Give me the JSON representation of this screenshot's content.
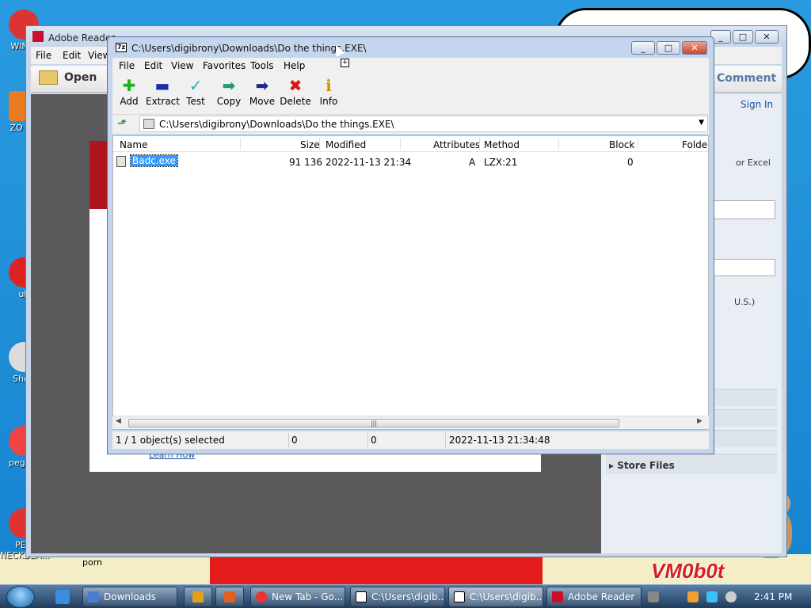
{
  "desktop": {
    "icons": [
      {
        "label": "WIN V"
      },
      {
        "label": "ZO DE"
      },
      {
        "label": "uk"
      },
      {
        "label": "Shop"
      },
      {
        "label": "peg he"
      },
      {
        "label": "PEG NECKBEA..."
      }
    ],
    "porn_label": "porn",
    "vmobot": "VM0b0t"
  },
  "reader": {
    "title": "Adobe Reader",
    "menu": [
      "File",
      "Edit",
      "View"
    ],
    "open_label": "Open",
    "comment_label": "Comment",
    "signin_label": "Sign In",
    "panel_text_excel": "or Excel",
    "panel_text_us": "U.S.)",
    "store_files": "Store Files",
    "doc_link": "Learn How"
  },
  "sevenzip": {
    "title": "C:\\Users\\digibrony\\Downloads\\Do the things.EXE\\",
    "menu": [
      "File",
      "Edit",
      "View",
      "Favorites",
      "Tools",
      "Help"
    ],
    "toolbar": [
      {
        "label": "Add",
        "icon": "plus-icon",
        "color": "#22b022"
      },
      {
        "label": "Extract",
        "icon": "minus-icon",
        "color": "#1a2fb0"
      },
      {
        "label": "Test",
        "icon": "check-icon",
        "color": "#2ab0a8"
      },
      {
        "label": "Copy",
        "icon": "copy-arrow-icon",
        "color": "#1f9a7a"
      },
      {
        "label": "Move",
        "icon": "move-arrow-icon",
        "color": "#1a2a90"
      },
      {
        "label": "Delete",
        "icon": "delete-x-icon",
        "color": "#d51818"
      },
      {
        "label": "Info",
        "icon": "info-icon",
        "color": "#c79800"
      }
    ],
    "address": "C:\\Users\\digibrony\\Downloads\\Do the things.EXE\\",
    "columns": [
      "Name",
      "Size",
      "Modified",
      "Attributes",
      "Method",
      "Block",
      "Folder"
    ],
    "rows": [
      {
        "name": "Badc.exe",
        "size": "91 136",
        "modified": "2022-11-13 21:34",
        "attributes": "A",
        "method": "LZX:21",
        "block": "0",
        "folder": ""
      }
    ],
    "status": {
      "selected": "1 / 1 object(s) selected",
      "size": "0",
      "packed": "0",
      "modified": "2022-11-13 21:34:48"
    }
  },
  "taskbar": {
    "tasks": [
      {
        "label": "Downloads"
      },
      {
        "label": ""
      },
      {
        "label": ""
      },
      {
        "label": "New Tab - Go..."
      },
      {
        "label": "C:\\Users\\digib..."
      },
      {
        "label": "C:\\Users\\digib..."
      },
      {
        "label": "Adobe Reader"
      }
    ],
    "clock": "2:41 PM"
  }
}
